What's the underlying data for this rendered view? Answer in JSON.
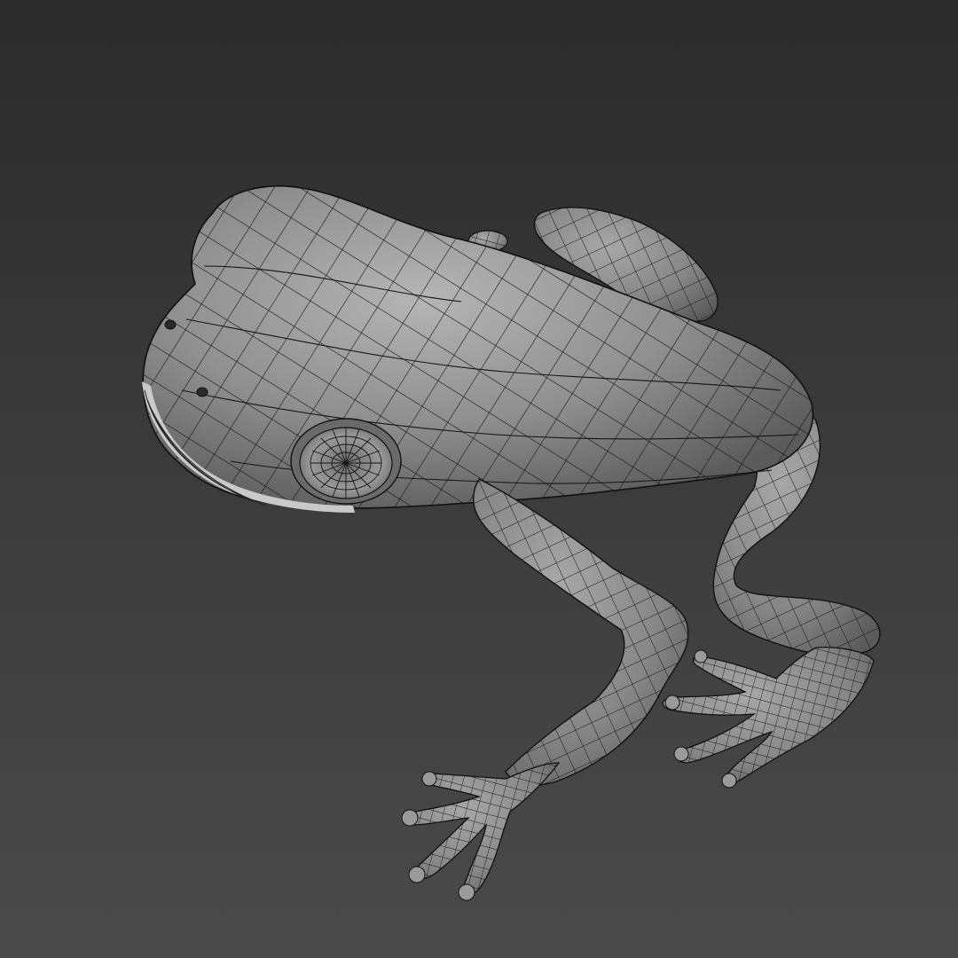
{
  "viewport": {
    "background_top": "#2b2b2b",
    "background_bottom": "#4a4a4a"
  },
  "model": {
    "subject": "frog",
    "render_mode": "shaded-wireframe",
    "surface_color": "#8e8e8e",
    "surface_highlight": "#b8b8b8",
    "surface_shadow": "#5a5a5a",
    "wire_color": "#141414"
  }
}
